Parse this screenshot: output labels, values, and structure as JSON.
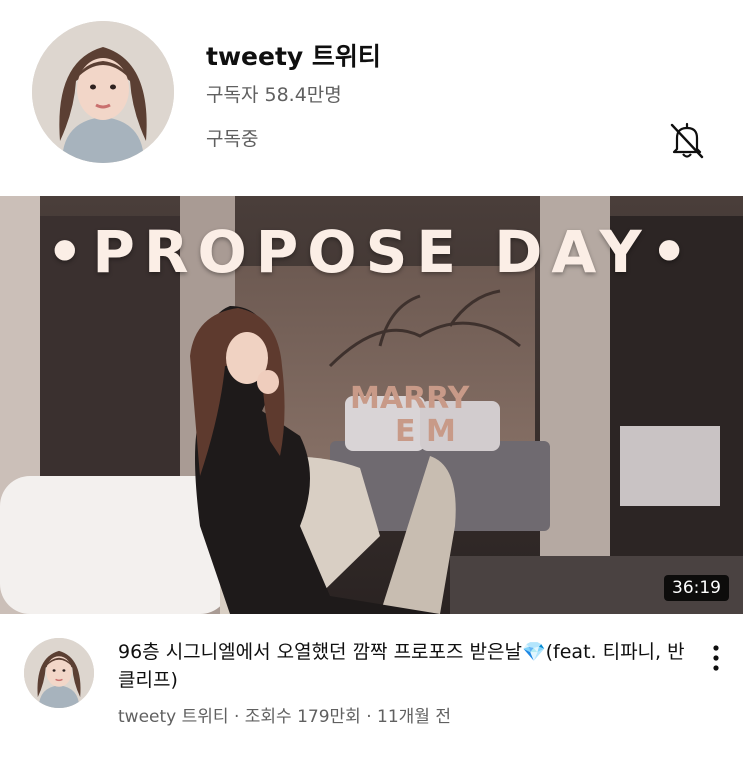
{
  "channel": {
    "name": "tweety 트위티",
    "subscribers": "구독자 58.4만명",
    "subscription_state": "구독중"
  },
  "video": {
    "thumbnail_text": "•PROPOSE DAY•",
    "duration": "36:19",
    "title": "96층 시그니엘에서 오열했던 깜짝 프로포즈 받은날💎(feat. 티파니, 반클리프)",
    "meta": "tweety 트위티 · 조회수 179만회 · 11개월 전"
  },
  "icons": {
    "bell": "bell-off-icon",
    "more": "more-vert-icon"
  }
}
